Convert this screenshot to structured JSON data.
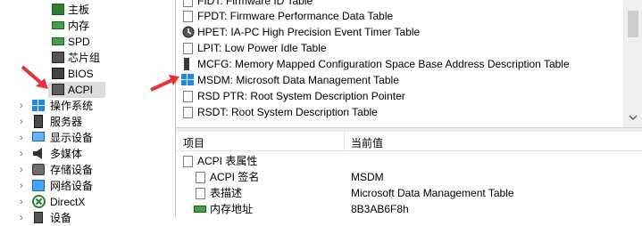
{
  "left_tree": {
    "items": [
      {
        "label": "主板",
        "icon": "motherboard-icon"
      },
      {
        "label": "内存",
        "icon": "memory-icon"
      },
      {
        "label": "SPD",
        "icon": "memory-icon"
      },
      {
        "label": "芯片组",
        "icon": "chipset-icon"
      },
      {
        "label": "BIOS",
        "icon": "bios-icon"
      },
      {
        "label": "ACPI",
        "icon": "acpi-icon"
      },
      {
        "label": "操作系统",
        "icon": "windows-icon"
      },
      {
        "label": "服务器",
        "icon": "server-icon"
      },
      {
        "label": "显示设备",
        "icon": "display-icon"
      },
      {
        "label": "多媒体",
        "icon": "multimedia-icon"
      },
      {
        "label": "存储设备",
        "icon": "storage-icon"
      },
      {
        "label": "网络设备",
        "icon": "network-icon"
      },
      {
        "label": "DirectX",
        "icon": "directx-icon"
      },
      {
        "label": "设备",
        "icon": "devices-icon"
      }
    ]
  },
  "table_list": {
    "items": [
      {
        "label": "FIDT: Firmware ID Table",
        "icon": "page-icon"
      },
      {
        "label": "FPDT: Firmware Performance Data Table",
        "icon": "page-icon"
      },
      {
        "label": "HPET: IA-PC High Precision Event Timer Table",
        "icon": "timer-icon"
      },
      {
        "label": "LPIT: Low Power Idle Table",
        "icon": "page-icon"
      },
      {
        "label": "MCFG: Memory Mapped Configuration Space Base Address Description Table",
        "icon": "memory-stick-icon"
      },
      {
        "label": "MSDM: Microsoft Data Management Table",
        "icon": "windows-icon"
      },
      {
        "label": "RSD PTR: Root System Description Pointer",
        "icon": "page-icon"
      },
      {
        "label": "RSDT: Root System Description Table",
        "icon": "page-icon"
      }
    ]
  },
  "details": {
    "col_item": "项目",
    "col_value": "当前值",
    "group_label": "ACPI 表属性",
    "rows": [
      {
        "label": "ACPI 签名",
        "value": "MSDM"
      },
      {
        "label": "表描述",
        "value": "Microsoft Data Management Table"
      },
      {
        "label": "内存地址",
        "value": "8B3AB6F8h"
      }
    ]
  },
  "colors": {
    "annotation_arrow": "#e8313a",
    "windows_blue": "#1e88e5"
  }
}
